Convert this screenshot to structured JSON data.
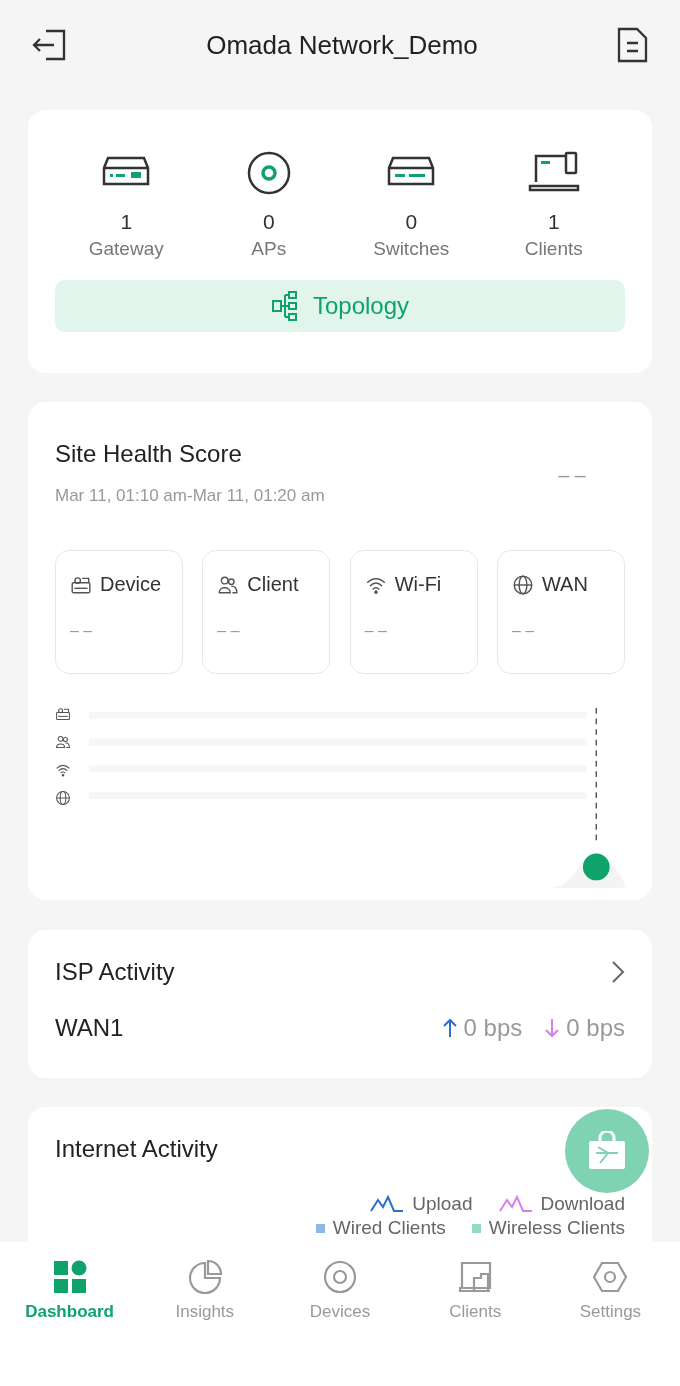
{
  "header": {
    "title": "Omada Network_Demo"
  },
  "device_summary": [
    {
      "kind": "gateway",
      "count": "1",
      "label": "Gateway"
    },
    {
      "kind": "ap",
      "count": "0",
      "label": "APs"
    },
    {
      "kind": "switch",
      "count": "0",
      "label": "Switches"
    },
    {
      "kind": "client",
      "count": "1",
      "label": "Clients"
    }
  ],
  "topology_button": {
    "label": "Topology"
  },
  "site_health": {
    "title": "Site Health Score",
    "time_range": "Mar 11, 01:10 am-Mar 11, 01:20 am",
    "score": "– –",
    "categories": [
      {
        "kind": "device",
        "label": "Device",
        "score": "– –"
      },
      {
        "kind": "client",
        "label": "Client",
        "score": "– –"
      },
      {
        "kind": "wifi",
        "label": "Wi-Fi",
        "score": "– –"
      },
      {
        "kind": "wan",
        "label": "WAN",
        "score": "– –"
      }
    ]
  },
  "isp_activity": {
    "title": "ISP Activity",
    "wan": "WAN1",
    "upload": "0 bps",
    "download": "0 bps"
  },
  "internet_activity": {
    "title": "Internet Activity",
    "legend": [
      {
        "kind": "line",
        "label": "Upload",
        "color": "#2a6fc9"
      },
      {
        "kind": "line",
        "label": "Download",
        "color": "#d77ff0"
      },
      {
        "kind": "square",
        "label": "Wired Clients",
        "color": "#8fb8e8"
      },
      {
        "kind": "square",
        "label": "Wireless Clients",
        "color": "#8fdcc0"
      }
    ]
  },
  "tabs": [
    {
      "kind": "dashboard",
      "label": "Dashboard",
      "selected": true
    },
    {
      "kind": "insights",
      "label": "Insights",
      "selected": false
    },
    {
      "kind": "devices",
      "label": "Devices",
      "selected": false
    },
    {
      "kind": "clients",
      "label": "Clients",
      "selected": false
    },
    {
      "kind": "settings",
      "label": "Settings",
      "selected": false
    }
  ]
}
